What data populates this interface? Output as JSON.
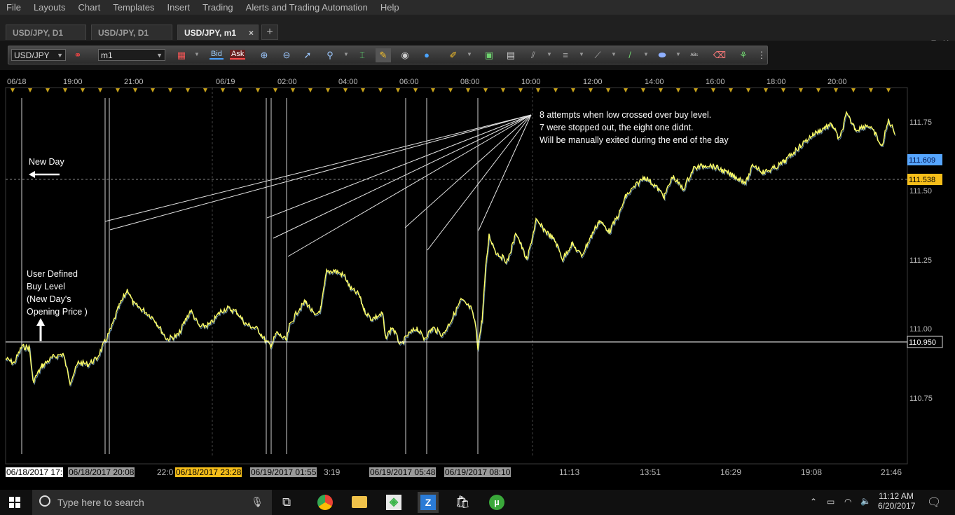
{
  "menu": [
    "File",
    "Layouts",
    "Chart",
    "Templates",
    "Insert",
    "Trading",
    "Alerts and Trading Automation",
    "Help"
  ],
  "tabs": [
    {
      "label": "USD/JPY, D1",
      "active": false
    },
    {
      "label": "USD/JPY, D1",
      "active": false
    },
    {
      "label": "USD/JPY, m1",
      "active": true
    }
  ],
  "tab_close": "×",
  "add_tab": "+",
  "toolbar": {
    "symbol": "USD/JPY",
    "timeframe": "m1",
    "bid_label": "Bid",
    "ask_label": "Ask"
  },
  "chart": {
    "time_axis_top": [
      "06/18",
      "19:00",
      "21:00",
      "06/19",
      "02:00",
      "04:00",
      "06:00",
      "08:00",
      "10:00",
      "12:00",
      "14:00",
      "16:00",
      "18:00",
      "20:00"
    ],
    "price_ticks": [
      "111.75",
      "111.50",
      "111.25",
      "111.00",
      "110.75"
    ],
    "price_badges": {
      "bid": "111.609",
      "ask": "111.538",
      "buy_level": "110.950"
    },
    "colors": {
      "bid_badge": "#56a6ff",
      "ask_badge": "#f6be1a",
      "price_line": "#ffff66",
      "buy_level_line": "#ffffff"
    },
    "annotations": {
      "new_day": "New Day",
      "buy_level": [
        "User Defined",
        "Buy Level",
        "(New Day's",
        "Opening Price )"
      ],
      "attempts": [
        "8 attempts when low crossed over buy level.",
        "7 were stopped out, the eight one didnt.",
        "Will be manually exited during the end of the day"
      ]
    },
    "bottom_labels": [
      "06/18/2017 17:",
      "06/18/2017 20:08",
      "22:0",
      "06/18/2017 23:28",
      "06/19/2017 01:55",
      "3:19",
      "06/19/2017 05:48",
      "06/19/2017 08:10",
      "11:13",
      "13:51",
      "16:29",
      "19:08",
      "21:46"
    ]
  },
  "taskbar": {
    "search_placeholder": "Type here to search",
    "time": "11:12 AM",
    "date": "6/20/2017"
  }
}
